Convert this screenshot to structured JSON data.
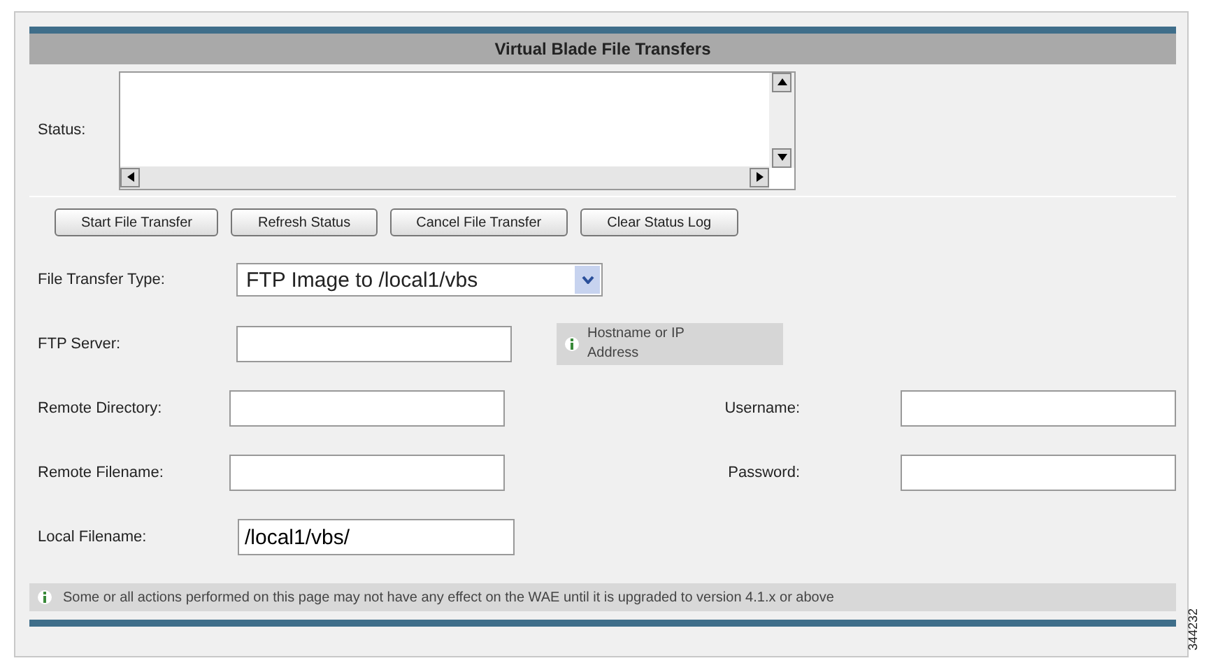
{
  "title": "Virtual Blade File Transfers",
  "status": {
    "label": "Status:"
  },
  "buttons": [
    "Start File Transfer",
    "Refresh Status",
    "Cancel File Transfer",
    "Clear Status Log"
  ],
  "transfer_type": {
    "label": "File Transfer Type:",
    "value": "FTP Image to /local1/vbs"
  },
  "ftp_server": {
    "label": "FTP Server:",
    "hint": "Hostname or IP Address"
  },
  "fields": [
    {
      "label": "Remote Directory:"
    },
    {
      "label": "Username:"
    },
    {
      "label": "Remote Filename:"
    },
    {
      "label": "Password:"
    }
  ],
  "local_filename": {
    "label": "Local Filename:",
    "value": "/local1/vbs/"
  },
  "notice": "Some or all actions performed on this page may not have any effect on the WAE until it is upgraded to version 4.1.x or above",
  "figure_id": "344232"
}
